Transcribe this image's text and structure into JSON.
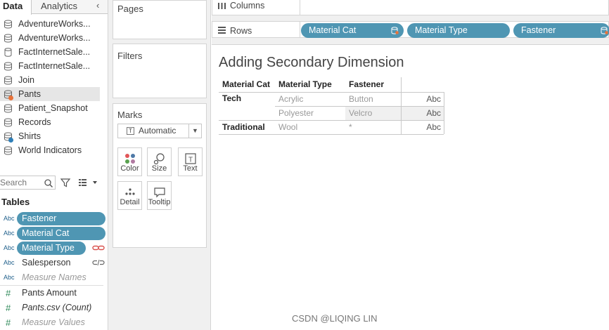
{
  "tabs": {
    "data": "Data",
    "analytics": "Analytics"
  },
  "datasources": [
    {
      "label": "AdventureWorks...",
      "icon": "datasource-icon"
    },
    {
      "label": "AdventureWorks...",
      "icon": "datasource-icon"
    },
    {
      "label": "FactInternetSale...",
      "icon": "database-cylinder-icon"
    },
    {
      "label": "FactInternetSale...",
      "icon": "datasource-icon"
    },
    {
      "label": "Join",
      "icon": "datasource-icon"
    },
    {
      "label": "Pants",
      "icon": "datasource-icon",
      "badge": "primary-orange"
    },
    {
      "label": "Patient_Snapshot",
      "icon": "datasource-icon"
    },
    {
      "label": "Records",
      "icon": "datasource-icon"
    },
    {
      "label": "Shirts",
      "icon": "datasource-icon",
      "badge": "secondary-blue"
    },
    {
      "label": "World Indicators",
      "icon": "datasource-icon"
    }
  ],
  "search": {
    "placeholder": "Search"
  },
  "tables_title": "Tables",
  "fields": [
    {
      "type": "Abc",
      "label": "Fastener"
    },
    {
      "type": "Abc",
      "label": "Material Cat"
    },
    {
      "type": "Abc",
      "label": "Material Type"
    },
    {
      "type": "Abc",
      "label": "Salesperson"
    },
    {
      "type": "Abc",
      "label": "Measure Names"
    },
    {
      "type": "#",
      "label": "Pants Amount"
    },
    {
      "type": "#",
      "label": "Pants.csv (Count)"
    },
    {
      "type": "#",
      "label": "Measure Values"
    }
  ],
  "cards": {
    "pages": "Pages",
    "filters": "Filters",
    "marks": "Marks"
  },
  "marks": {
    "dropdown": "Automatic",
    "buttons": {
      "color": "Color",
      "size": "Size",
      "text": "Text",
      "detail": "Detail",
      "tooltip": "Tooltip"
    }
  },
  "shelves": {
    "columns": "Columns",
    "rows": "Rows",
    "row_pills": [
      "Material Cat",
      "Material Type",
      "Fastener"
    ]
  },
  "sheet": {
    "title": "Adding Secondary Dimension",
    "headers": [
      "Material Cat",
      "Material Type",
      "Fastener"
    ],
    "rows": [
      {
        "cat": "Tech",
        "type": "Acrylic",
        "fastener": "Button",
        "value": "Abc"
      },
      {
        "cat": "",
        "type": "Polyester",
        "fastener": "Velcro",
        "value": "Abc"
      },
      {
        "cat": "Traditional",
        "type": "Wool",
        "fastener": "*",
        "value": "Abc"
      }
    ]
  },
  "watermark": "CSDN @LIQING LIN",
  "colors": {
    "pill": "#4f96b3",
    "primary_badge": "#e8733a",
    "secondary_badge": "#2f7fb8",
    "link_broken": "#d9534f"
  }
}
